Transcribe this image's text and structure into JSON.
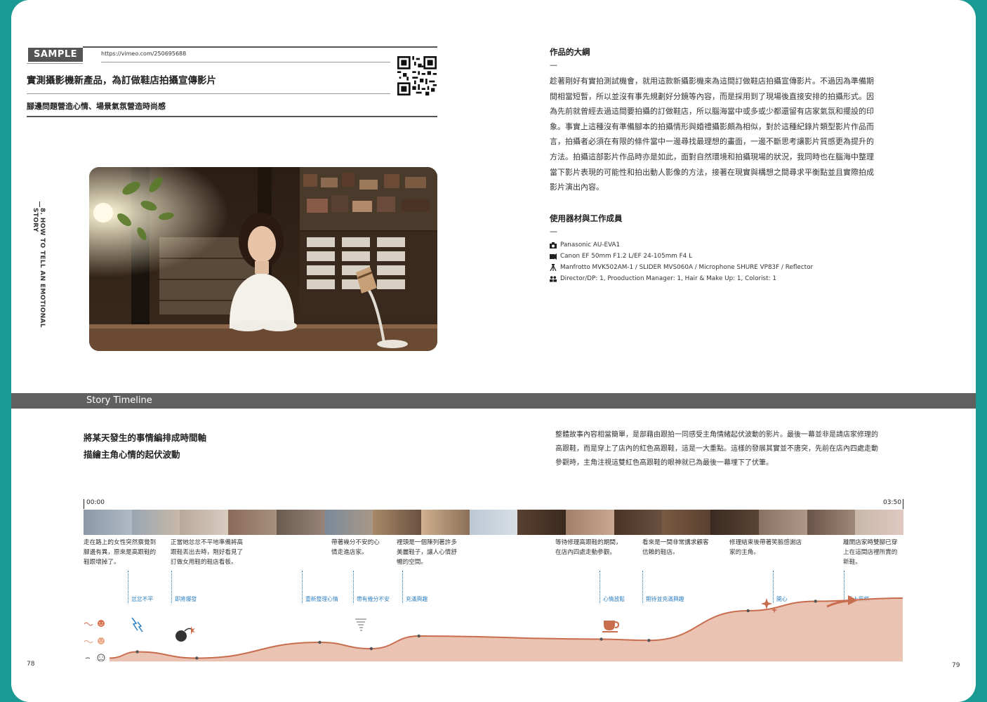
{
  "left_page": {
    "sample_label": "SAMPLE 2:",
    "url": "https://vimeo.com/250695688",
    "title": "實測攝影機新產品，為訂做鞋店拍攝宣傳影片",
    "subtitle": "腳邊問題營造心情、場景氣氛營造時尚感",
    "side_chapter": "8. HOW TO TELL AN EMOTIONAL STORY",
    "page_number": "78"
  },
  "right_page": {
    "outline_heading": "作品的大綱",
    "dash": "—",
    "outline_lines": [
      "趁著剛好有實拍測試機會，就用這款新攝影機來為這間訂做鞋店拍攝宣傳影片。不過因為準備期",
      "間相當短暫，所以並沒有事先規劃好分鏡等內容，而是採用到了現場後直接安排的拍攝形式。因",
      "為先前就曾經去過這間要拍攝的訂做鞋店，所以腦海當中或多或少都還留有店家氣氛和擺設的印",
      "象。事實上這種沒有準備腳本的拍攝情形與婚禮攝影頗為相似，對於這種紀錄片類型影片作品而",
      "言，拍攝者必須在有限的條件當中一邊尋找最理想的畫面，一邊不斷思考讓影片質感更為提升的",
      "方法。拍攝這部影片作品時亦是如此，面對自然環境和拍攝現場的狀況，我同時也在腦海中整理",
      "當下影片表現的可能性和拍出動人影像的方法，接著在現實與構想之間尋求平衡點並且實際拍成",
      "影片演出內容。"
    ],
    "equipment_heading": "使用器材與工作成員",
    "equipment": [
      {
        "icon": "camera-icon",
        "text": "Panasonic AU-EVA1"
      },
      {
        "icon": "lens-icon",
        "text": "Canon EF 50mm F1.2 L/EF 24-105mm F4 L"
      },
      {
        "icon": "tripod-icon",
        "text": "Manfrotto MVK502AM-1 / SLIDER  MVS060A / Microphone  SHURE VP83F / Reflector"
      },
      {
        "icon": "crew-icon",
        "text": "Director/DP: 1,  Prooduction Manager: 1,  Hair & Make Up: 1,  Colorist: 1"
      }
    ],
    "page_number": "79"
  },
  "timeline": {
    "band_label": "Story Timeline",
    "heading_lines": [
      "將某天發生的事情編排成時間軸",
      "描繪主角心情的起伏波動"
    ],
    "summary_lines": [
      "整體故事內容相當簡單，是部藉由跟拍一同感受主角情緒起伏波動的影片。最後一幕並非是請店家修理的",
      "高跟鞋，而是穿上了店內的紅色高跟鞋，這是一大重點。這樣的發展其實並不唐突，先前在店內四處走動",
      "參觀時，主角注視這雙紅色高跟鞋的眼神就已為最後一幕埋下了伏筆。"
    ],
    "start_time": "00:00",
    "end_time": "03:50",
    "captions": [
      {
        "lines": [
          "走在路上的女性突然察覺到",
          "腳邊有異，原來是高跟鞋的",
          "鞋跟壞掉了。"
        ]
      },
      {
        "lines": [
          "正當她忿忿不平地準備將高",
          "跟鞋丟出去時，剛好看見了",
          "訂做女用鞋的鞋店看板。"
        ]
      },
      {
        "lines": [
          "帶著幾分不安的心",
          "情走進店家。"
        ]
      },
      {
        "lines": [
          "裡頭是一個陳列著許多",
          "美麗鞋子，讓人心情舒",
          "暢的空間。"
        ]
      },
      {
        "lines": [
          "等待修理高跟鞋的期間，",
          "在店內四處走動參觀。"
        ]
      },
      {
        "lines": [
          "看來是一間非常講求顧客",
          "信賴的鞋店。"
        ]
      },
      {
        "lines": [
          "修理結束後帶著笑臉感謝店",
          "家的主角。"
        ]
      },
      {
        "lines": [
          "離開店家時雙腳已穿",
          "上在這間店裡所賣的",
          "新鞋。"
        ]
      }
    ],
    "moods": [
      "忿忿不平",
      "即將爆發",
      "重新整理心情",
      "帶有幾分不安",
      "充滿興趣",
      "心情放鬆",
      "期待並充滿興趣",
      "開心",
      "喜上眉梢"
    ],
    "mood_scale_icons": [
      "happy-face-icon",
      "neutral-face-icon",
      "sad-face-icon"
    ],
    "chart_data": {
      "type": "area",
      "title": "",
      "xlabel": "",
      "ylabel": "",
      "x": [
        0,
        7,
        22,
        53,
        66,
        78,
        124,
        136,
        161,
        178,
        200
      ],
      "values": [
        0.05,
        0.15,
        0.05,
        0.3,
        0.2,
        0.4,
        0.35,
        0.33,
        0.8,
        0.95,
        1.0
      ]
    },
    "accent_color": "#c96d4f"
  }
}
